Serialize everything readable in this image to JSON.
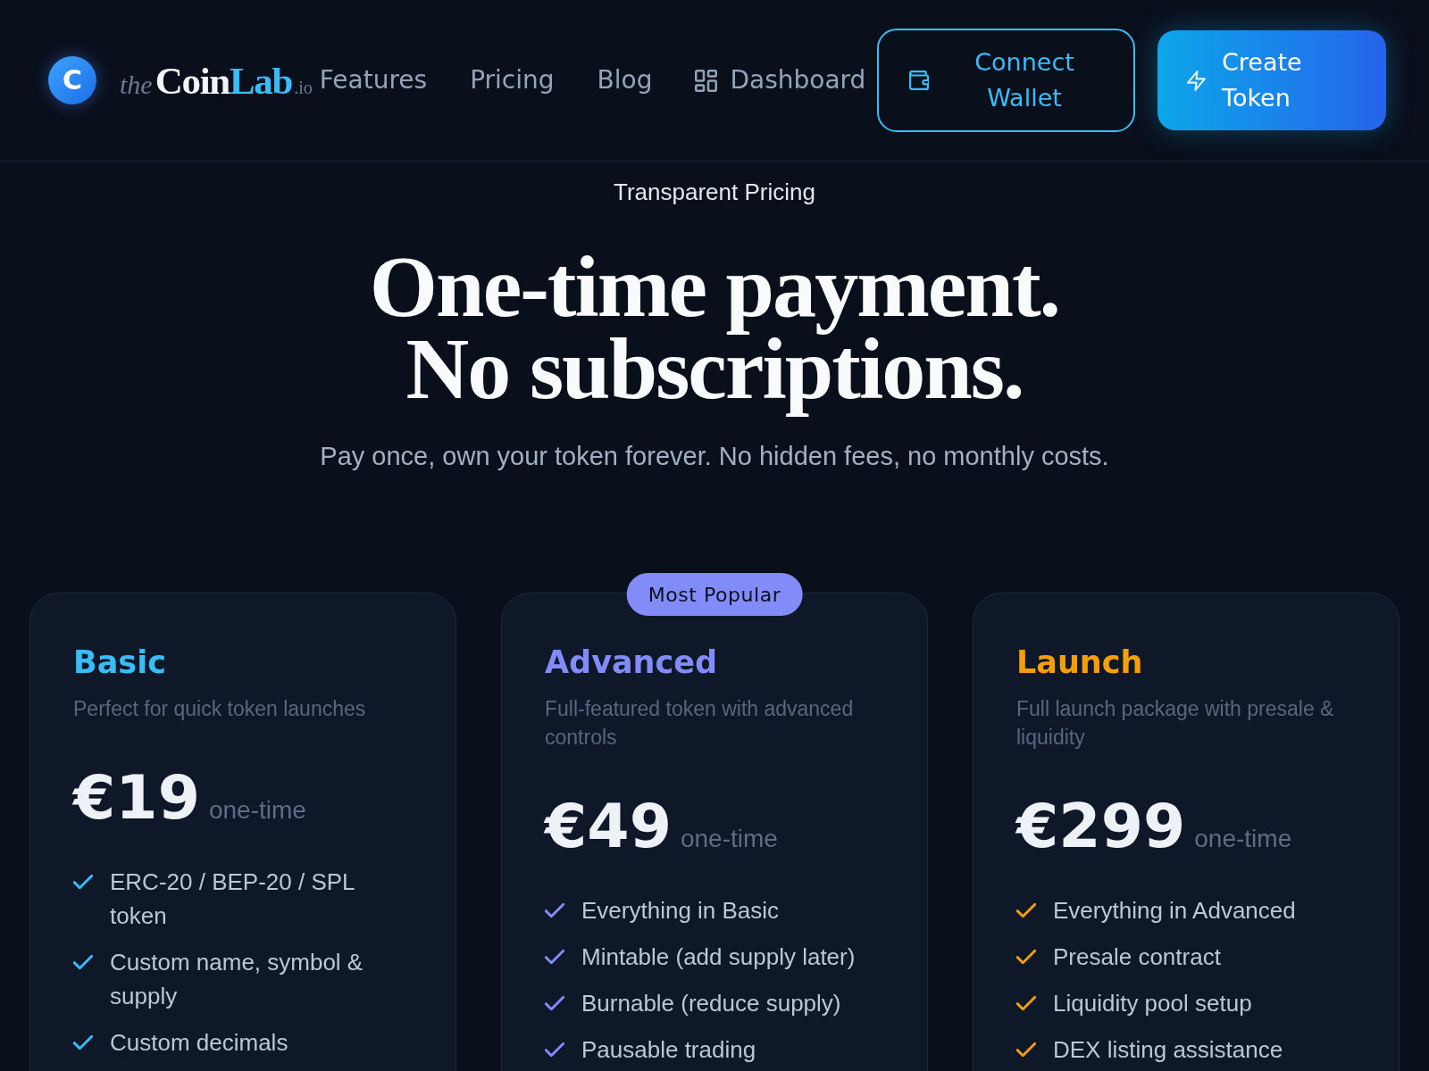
{
  "header": {
    "logo": {
      "mark": "C",
      "wordmark": [
        {
          "text": "the",
          "kind": "prefix"
        },
        {
          "text": "Coin",
          "kind": "name"
        },
        {
          "text": "Lab",
          "kind": "accent"
        },
        {
          "text": ".io",
          "kind": "suffix"
        }
      ]
    },
    "nav": [
      {
        "label": "Features",
        "kind": "text"
      },
      {
        "label": "Pricing",
        "kind": "text"
      },
      {
        "label": "Blog",
        "kind": "text"
      },
      {
        "label": "Dashboard",
        "kind": "icon"
      }
    ],
    "buttons": [
      {
        "label": "Connect Wallet",
        "kind": "outline"
      },
      {
        "label": "Create Token",
        "kind": "primary"
      }
    ]
  },
  "hero": {
    "eyebrow": "Transparent Pricing",
    "headline": [
      "One-time payment.",
      "No subscriptions."
    ],
    "subtitle": "Pay once, own your token forever. No hidden fees, no monthly costs."
  },
  "plans": [
    {
      "name": "Basic",
      "color": "#38bdf8",
      "description": "Perfect for quick token launches",
      "price": "€19",
      "period": "one-time",
      "features": [
        "ERC-20 / BEP-20 / SPL token",
        "Custom name, symbol & supply",
        "Custom decimals"
      ]
    },
    {
      "name": "Advanced",
      "color": "#818cf8",
      "badge": "Most Popular",
      "description": "Full-featured token with advanced controls",
      "price": "€49",
      "period": "one-time",
      "features": [
        "Everything in Basic",
        "Mintable (add supply later)",
        "Burnable (reduce supply)",
        "Pausable trading"
      ]
    },
    {
      "name": "Launch",
      "color": "#f59e0b",
      "description": "Full launch package with presale & liquidity",
      "price": "€299",
      "period": "one-time",
      "features": [
        "Everything in Advanced",
        "Presale contract",
        "Liquidity pool setup",
        "DEX listing assistance"
      ]
    }
  ]
}
